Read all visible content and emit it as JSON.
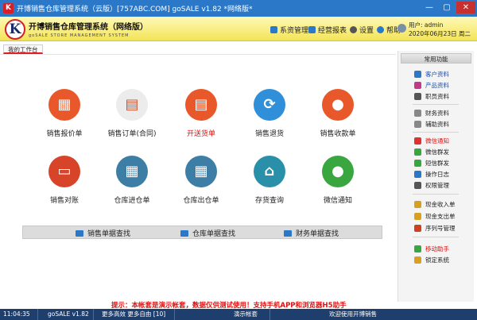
{
  "window": {
    "title": "开博销售仓库管理系统（云版）[757ABC.COM]  goSALE v1.82   *网络版*",
    "app_icon_letter": "K",
    "buttons": [
      "—",
      "▢",
      "✕"
    ]
  },
  "header": {
    "logo_letter": "K",
    "brand_cn": "开博销售仓库管理系统（网络版）",
    "brand_en": "goSALE STORE MANAGEMENT SYSTEM",
    "nav": [
      {
        "label": "系资管理",
        "icon": "grid-icon",
        "color": "#2b78c8"
      },
      {
        "label": "经营报表",
        "icon": "chart-icon",
        "color": "#2b78c8"
      },
      {
        "label": "设置",
        "icon": "gear-icon",
        "color": "#555555"
      },
      {
        "label": "帮助",
        "icon": "help-icon",
        "color": "#2b78c8"
      }
    ],
    "user_line": "用户: admin",
    "date_line": "2020年06月23日 周二"
  },
  "tab": {
    "label": "我的工作台"
  },
  "tiles": [
    {
      "label": "销售报价单",
      "color": "#e8582a",
      "glyph": "▦",
      "icon": "calculator-icon"
    },
    {
      "label": "销售订单(合同)",
      "color": "#ececec",
      "glyph": "▤",
      "icon": "book-icon"
    },
    {
      "label": "开送货单",
      "color": "#e8582a",
      "glyph": "▤",
      "icon": "clipboard-icon",
      "highlight": true
    },
    {
      "label": "销售退货",
      "color": "#2f8fd8",
      "glyph": "⟳",
      "icon": "refresh-icon"
    },
    {
      "label": "销售收款单",
      "color": "#e8582a",
      "glyph": "●",
      "icon": "money-bag-icon"
    },
    {
      "label": "销售对账",
      "color": "#d8442a",
      "glyph": "▭",
      "icon": "laptop-icon"
    },
    {
      "label": "仓库进仓单",
      "color": "#3d7ea6",
      "glyph": "▦",
      "icon": "warehouse-in-icon"
    },
    {
      "label": "仓库出仓单",
      "color": "#3d7ea6",
      "glyph": "▦",
      "icon": "warehouse-out-icon"
    },
    {
      "label": "存货查询",
      "color": "#2a8fa8",
      "glyph": "⌂",
      "icon": "house-icon"
    },
    {
      "label": "微信通知",
      "color": "#3aa640",
      "glyph": "●",
      "icon": "wechat-icon"
    }
  ],
  "querybar": [
    {
      "label": "销售单据查找",
      "icon": "monitor-icon"
    },
    {
      "label": "仓库单据查找",
      "icon": "monitor-icon"
    },
    {
      "label": "财务单据查找",
      "icon": "monitor-icon"
    }
  ],
  "sidebar": {
    "title": "常用功能",
    "items": [
      {
        "label": "客户资料",
        "icon": "customers-icon",
        "color": "#2b78c8",
        "link": true
      },
      {
        "label": "产品资料",
        "icon": "products-icon",
        "color": "#c03a8a",
        "link": true
      },
      {
        "label": "职员资料",
        "icon": "staff-icon",
        "color": "#555555",
        "link": false
      },
      {
        "label": "财务资料",
        "icon": "finance-icon",
        "color": "#888888",
        "link": false
      },
      {
        "label": "辅助资料",
        "icon": "aux-icon",
        "color": "#888888",
        "link": false
      },
      {
        "label": "微信通知",
        "icon": "wechat-icon",
        "color": "#e23030",
        "link": true,
        "red": true
      },
      {
        "label": "微信群发",
        "icon": "wechat-icon",
        "color": "#3aa640",
        "link": false
      },
      {
        "label": "短信群发",
        "icon": "sms-icon",
        "color": "#3aa640",
        "link": false
      },
      {
        "label": "操作日志",
        "icon": "log-icon",
        "color": "#2b78c8",
        "link": false
      },
      {
        "label": "权限管理",
        "icon": "monitor-icon",
        "color": "#555555",
        "link": false
      },
      {
        "label": "现金收入单",
        "icon": "cash-in-icon",
        "color": "#d8a020",
        "link": false
      },
      {
        "label": "现金支出单",
        "icon": "cash-out-icon",
        "color": "#d8a020",
        "link": false
      },
      {
        "label": "序列号管理",
        "icon": "serial-icon",
        "color": "#d04020",
        "link": false
      },
      {
        "label": "移动助手",
        "icon": "mobile-icon",
        "color": "#3aa640",
        "link": true,
        "red": true
      },
      {
        "label": "锁定系统",
        "icon": "lock-icon",
        "color": "#d8a020",
        "link": false
      }
    ]
  },
  "notice": "提示：本帐套是演示帐套，数据仅供测试使用！支持手机APP和浏览器H5助手",
  "statusbar": {
    "time": "11:04:35",
    "version": "goSALE v1.82",
    "hint": "更多高效 更多自由 [10]",
    "account": "演示帐套",
    "welcome": "欢迎使用开博销售"
  }
}
